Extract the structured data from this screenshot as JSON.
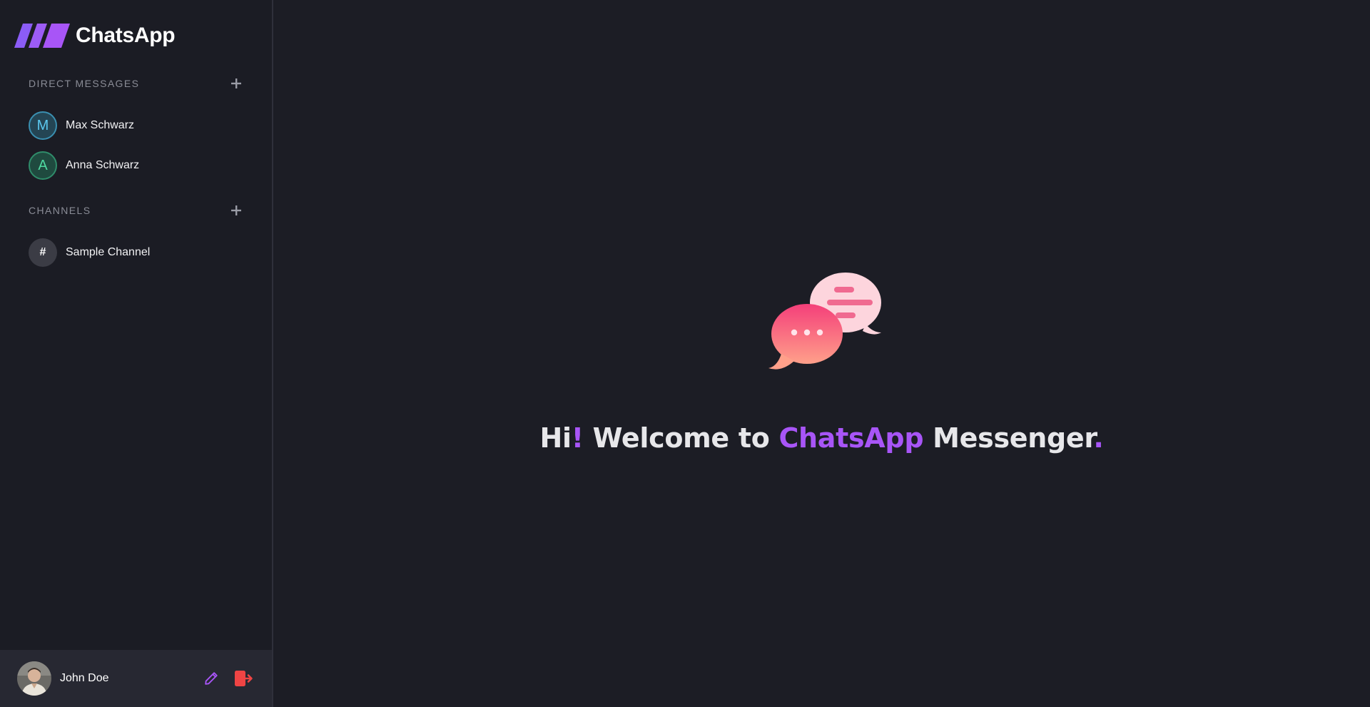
{
  "app": {
    "name": "ChatsApp"
  },
  "sidebar": {
    "direct_messages": {
      "title": "DIRECT MESSAGES",
      "items": [
        {
          "initial": "M",
          "name": "Max Schwarz"
        },
        {
          "initial": "A",
          "name": "Anna Schwarz"
        }
      ]
    },
    "channels": {
      "title": "CHANNELS",
      "items": [
        {
          "initial": "#",
          "name": "Sample Channel"
        }
      ]
    },
    "user": {
      "name": "John Doe"
    }
  },
  "main": {
    "welcome": {
      "part1": "Hi",
      "bang": "!",
      "part2": " Welcome to ",
      "brand": "ChatsApp",
      "part3": " Messenger",
      "dot": "."
    }
  },
  "colors": {
    "accent": "#a855f7",
    "logout": "#ef4444",
    "background": "#1c1d25",
    "sidebar": "#1b1c24",
    "user_bar": "#272832"
  },
  "icons": {
    "logo": "logo-stripes-icon",
    "add": "plus-icon",
    "edit": "pencil-icon",
    "logout": "logout-icon",
    "illustration": "chat-bubbles-icon"
  }
}
